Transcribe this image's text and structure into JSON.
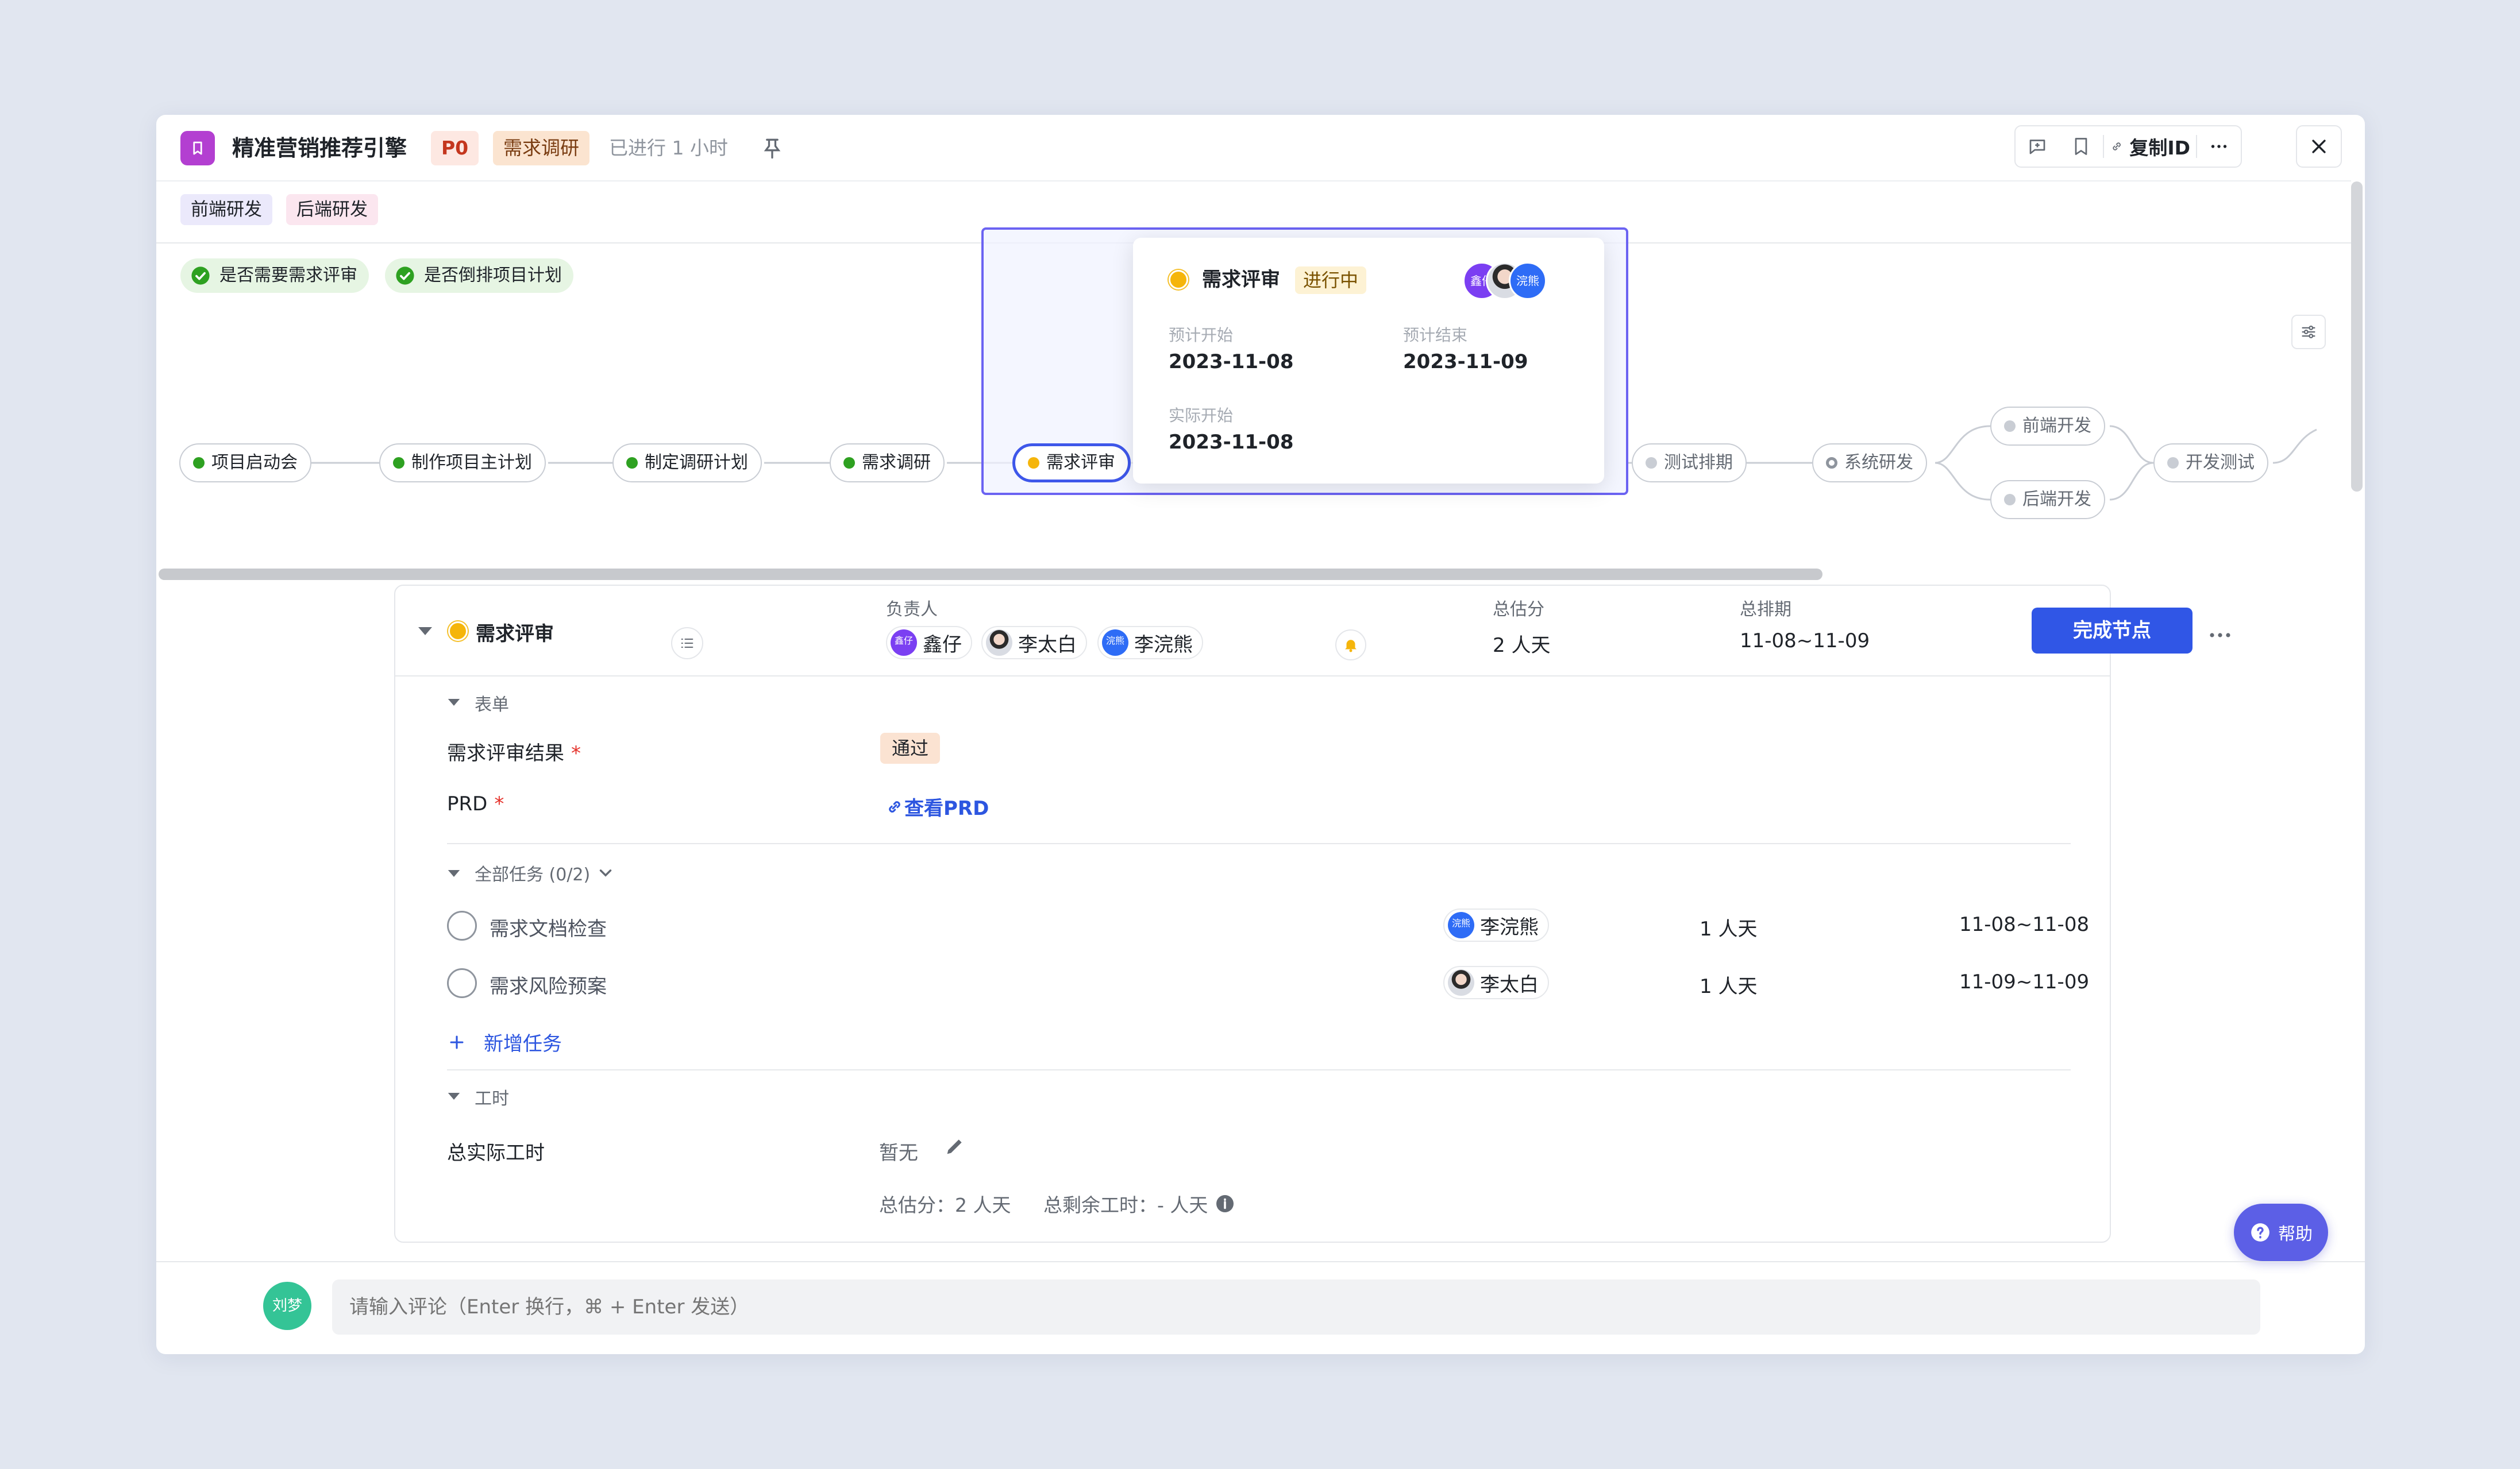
{
  "header": {
    "title": "精准营销推荐引擎",
    "priority": "P0",
    "stage": "需求调研",
    "elapsed": "已进行 1 小时",
    "copy_id_label": "复制ID"
  },
  "teams": [
    "前端研发",
    "后端研发"
  ],
  "conditions": [
    "是否需要需求评审",
    "是否倒排项目计划"
  ],
  "flow": {
    "nodes": [
      {
        "label": "项目启动会",
        "state": "done"
      },
      {
        "label": "制作项目主计划",
        "state": "done"
      },
      {
        "label": "制定调研计划",
        "state": "done"
      },
      {
        "label": "需求调研",
        "state": "done"
      },
      {
        "label": "需求评审",
        "state": "active"
      },
      {
        "label": "测试排期",
        "state": "pending"
      },
      {
        "label": "系统研发",
        "state": "pending"
      },
      {
        "label": "前端开发",
        "state": "pending"
      },
      {
        "label": "后端开发",
        "state": "pending"
      },
      {
        "label": "开发测试",
        "state": "pending"
      }
    ]
  },
  "tooltip": {
    "name": "需求评审",
    "status": "进行中",
    "plan_start_label": "预计开始",
    "plan_start": "2023-11-08",
    "plan_end_label": "预计结束",
    "plan_end": "2023-11-09",
    "actual_start_label": "实际开始",
    "actual_start": "2023-11-08",
    "avatars": [
      "鑫仔",
      "",
      "浣熊"
    ]
  },
  "card": {
    "node_name": "需求评审",
    "owner_label": "负责人",
    "owners": [
      {
        "name": "鑫仔",
        "avatar_text": "鑫仔",
        "avatar": "purple"
      },
      {
        "name": "李太白",
        "avatar_text": "",
        "avatar": "photo"
      },
      {
        "name": "李浣熊",
        "avatar_text": "浣熊",
        "avatar": "blue"
      }
    ],
    "estimate_label": "总估分",
    "estimate": "2 人天",
    "schedule_label": "总排期",
    "schedule": "11-08~11-09",
    "complete_button": "完成节点",
    "form_section": "表单",
    "form": {
      "result_label": "需求评审结果",
      "result_value": "通过",
      "prd_label": "PRD",
      "prd_link": "查看PRD",
      "required_mark": "*"
    },
    "tasks_section": "全部任务 (0/2)",
    "tasks": [
      {
        "name": "需求文档检查",
        "assignee": "李浣熊",
        "avatar_text": "浣熊",
        "avatar": "blue",
        "effort": "1 人天",
        "range": "11-08~11-08"
      },
      {
        "name": "需求风险预案",
        "assignee": "李太白",
        "avatar_text": "",
        "avatar": "photo",
        "effort": "1 人天",
        "range": "11-09~11-09"
      }
    ],
    "add_task": "新增任务",
    "hours_section": "工时",
    "hours_label": "总实际工时",
    "hours_value": "暂无",
    "hours_summary": "总估分：2 人天",
    "hours_remaining": "总剩余工时：- 人天"
  },
  "help": "帮助",
  "comment": {
    "avatar_text": "刘梦",
    "placeholder": "请输入评论（Enter 换行，⌘ + Enter 发送）"
  },
  "colors": {
    "accent": "#3056e6",
    "done": "#2ea121",
    "active": "#f5b50b",
    "pending": "#c9cdd4"
  }
}
